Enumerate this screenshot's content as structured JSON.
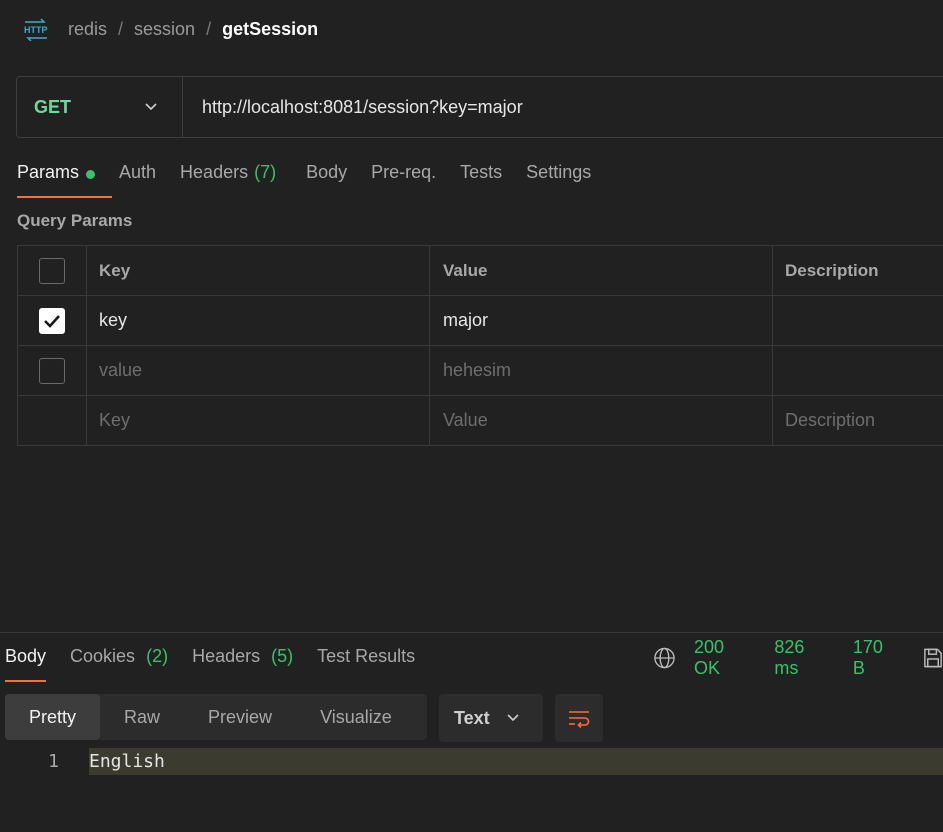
{
  "breadcrumb": {
    "parts": [
      "redis",
      "session"
    ],
    "separator": "/",
    "current": "getSession"
  },
  "request": {
    "method": "GET",
    "url": "http://localhost:8081/session?key=major"
  },
  "request_tabs": {
    "params": "Params",
    "auth": "Auth",
    "headers": "Headers",
    "headers_count": "(7)",
    "body": "Body",
    "prereq": "Pre-req.",
    "tests": "Tests",
    "settings": "Settings"
  },
  "query_params": {
    "title": "Query Params",
    "columns": [
      "Key",
      "Value",
      "Description"
    ],
    "rows": [
      {
        "checked": true,
        "key": "key",
        "value": "major",
        "description": ""
      },
      {
        "checked": false,
        "key": "value",
        "value": "hehesim",
        "description": ""
      }
    ],
    "placeholder": {
      "key": "Key",
      "value": "Value",
      "description": "Description"
    }
  },
  "response_tabs": {
    "body": "Body",
    "cookies": "Cookies",
    "cookies_count": "(2)",
    "headers": "Headers",
    "headers_count": "(5)",
    "test_results": "Test Results"
  },
  "response_status": {
    "status": "200 OK",
    "time": "826 ms",
    "size": "170 B"
  },
  "view_modes": {
    "pretty": "Pretty",
    "raw": "Raw",
    "preview": "Preview",
    "visualize": "Visualize",
    "format": "Text"
  },
  "response_body": {
    "line_number": "1",
    "line": "English"
  },
  "colors": {
    "accent": "#ff6c37",
    "method_get": "#6bdd9a",
    "success": "#39c26a",
    "background": "#212121"
  }
}
